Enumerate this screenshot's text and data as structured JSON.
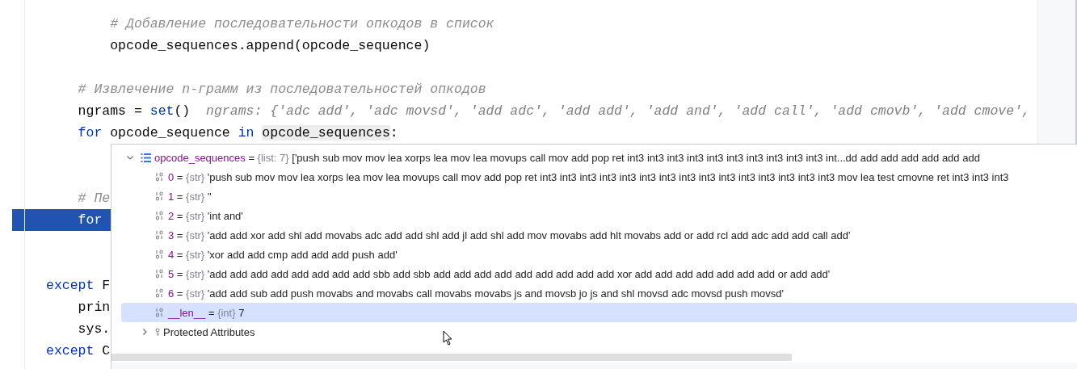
{
  "editor": {
    "lines": [
      {
        "kind": "code",
        "current": false,
        "tokens": [
          {
            "kind": "comment",
            "text": "        # Добавление последовательности опкодов в список"
          }
        ]
      },
      {
        "kind": "code",
        "current": false,
        "tokens": [
          {
            "kind": "plain",
            "text": "        opcode_sequences.append(opcode_sequence)"
          }
        ]
      },
      {
        "kind": "blank"
      },
      {
        "kind": "code",
        "current": false,
        "tokens": [
          {
            "kind": "comment",
            "text": "    # Извлечение n-грамм из последовательностей опкодов"
          }
        ]
      },
      {
        "kind": "code",
        "current": false,
        "tokens": [
          {
            "kind": "plain",
            "text": "    ngrams = "
          },
          {
            "kind": "keyword",
            "text": "set"
          },
          {
            "kind": "plain",
            "text": "()  "
          },
          {
            "kind": "hint",
            "text": "ngrams: {'adc add', 'adc movsd', 'add adc', 'add add', 'add and', 'add call', 'add cmovb', 'add cmove',"
          }
        ]
      },
      {
        "kind": "code",
        "current": false,
        "tokens": [
          {
            "kind": "keyword",
            "text": "    for"
          },
          {
            "kind": "plain",
            "text": " opcode_sequence "
          },
          {
            "kind": "keyword",
            "text": "in "
          },
          {
            "kind": "highlight",
            "text": "opcode_sequences"
          },
          {
            "kind": "plain",
            "text": ":"
          }
        ]
      },
      {
        "kind": "blank"
      },
      {
        "kind": "blank"
      },
      {
        "kind": "code",
        "current": false,
        "tokens": [
          {
            "kind": "comment",
            "text": "    # Пе"
          }
        ]
      },
      {
        "kind": "code",
        "current": true,
        "tokens": [
          {
            "kind": "keyword",
            "text": "    for"
          }
        ]
      },
      {
        "kind": "blank"
      },
      {
        "kind": "blank"
      },
      {
        "kind": "code",
        "current": false,
        "tokens": [
          {
            "kind": "keyword",
            "text": "except"
          },
          {
            "kind": "plain",
            "text": " F"
          }
        ]
      },
      {
        "kind": "code",
        "current": false,
        "tokens": [
          {
            "kind": "plain",
            "text": "    prin"
          }
        ]
      },
      {
        "kind": "code",
        "current": false,
        "tokens": [
          {
            "kind": "plain",
            "text": "    sys."
          }
        ]
      },
      {
        "kind": "code",
        "current": false,
        "tokens": [
          {
            "kind": "keyword",
            "text": "except"
          },
          {
            "kind": "plain",
            "text": " C"
          }
        ]
      }
    ]
  },
  "debugger_popup": {
    "variable": {
      "name": "opcode_sequences",
      "operator": "=",
      "type": "{list: 7}",
      "value": "['push sub mov mov lea xorps lea mov lea movups call mov add pop ret int3 int3 int3 int3 int3 int3 int3 int3 int3 int3 int...dd add add add add add add",
      "expanded": true,
      "children": [
        {
          "name": "0",
          "operator": "=",
          "type": "{str}",
          "value": "'push sub mov mov lea xorps lea mov lea movups call mov add pop ret int3 int3 int3 int3 int3 int3 int3 int3 int3 int3 int3 int3 int3 int3 int3 mov lea test cmovne ret int3 int3 int3",
          "selected": false
        },
        {
          "name": "1",
          "operator": "=",
          "type": "{str}",
          "value": "''",
          "selected": false
        },
        {
          "name": "2",
          "operator": "=",
          "type": "{str}",
          "value": "'int and'",
          "selected": false
        },
        {
          "name": "3",
          "operator": "=",
          "type": "{str}",
          "value": "'add add xor add shl add movabs adc add add shl add jl add shl add mov movabs add hlt movabs add or add rcl add adc add add call add'",
          "selected": false
        },
        {
          "name": "4",
          "operator": "=",
          "type": "{str}",
          "value": "'xor add add cmp add add add push add'",
          "selected": false
        },
        {
          "name": "5",
          "operator": "=",
          "type": "{str}",
          "value": "'add add add add add add add add sbb add sbb add add add add add add add add add xor add add add add add add add or add add'",
          "selected": false
        },
        {
          "name": "6",
          "operator": "=",
          "type": "{str}",
          "value": "'add add sub add push movabs and movabs call movabs movabs js and movsb jo js and shl movsd adc movsd push movsd'",
          "selected": false
        },
        {
          "name": "__len__",
          "operator": "=",
          "type": "{int}",
          "value": "7",
          "selected": true
        }
      ]
    },
    "protected_attributes": {
      "label": "Protected Attributes",
      "expanded": false
    }
  }
}
